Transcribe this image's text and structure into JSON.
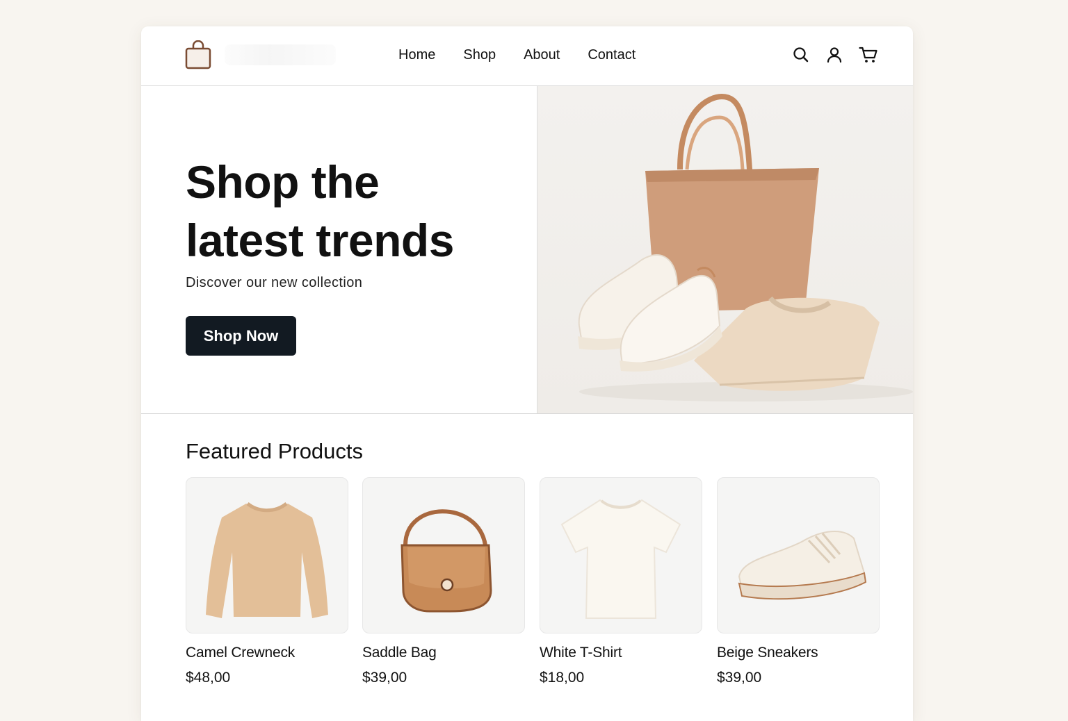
{
  "header": {
    "logo_icon": "shopping-bag-icon",
    "nav": [
      "Home",
      "Shop",
      "About",
      "Contact"
    ],
    "icons": [
      "search-icon",
      "user-icon",
      "cart-icon"
    ]
  },
  "hero": {
    "title_line1": "Shop the",
    "title_line2": "latest trends",
    "subtitle": "Discover our new collection",
    "cta_label": "Shop Now"
  },
  "featured": {
    "title": "Featured Products",
    "products": [
      {
        "name": "Camel Crewneck",
        "price": "$48,00"
      },
      {
        "name": "Saddle Bag",
        "price": "$39,00"
      },
      {
        "name": "White T-Shirt",
        "price": "$18,00"
      },
      {
        "name": "Beige Sneakers",
        "price": "$39,00"
      }
    ]
  },
  "colors": {
    "page_bg": "#f8f5f0",
    "accent_tan": "#c8916c",
    "button_bg": "#121a22"
  }
}
